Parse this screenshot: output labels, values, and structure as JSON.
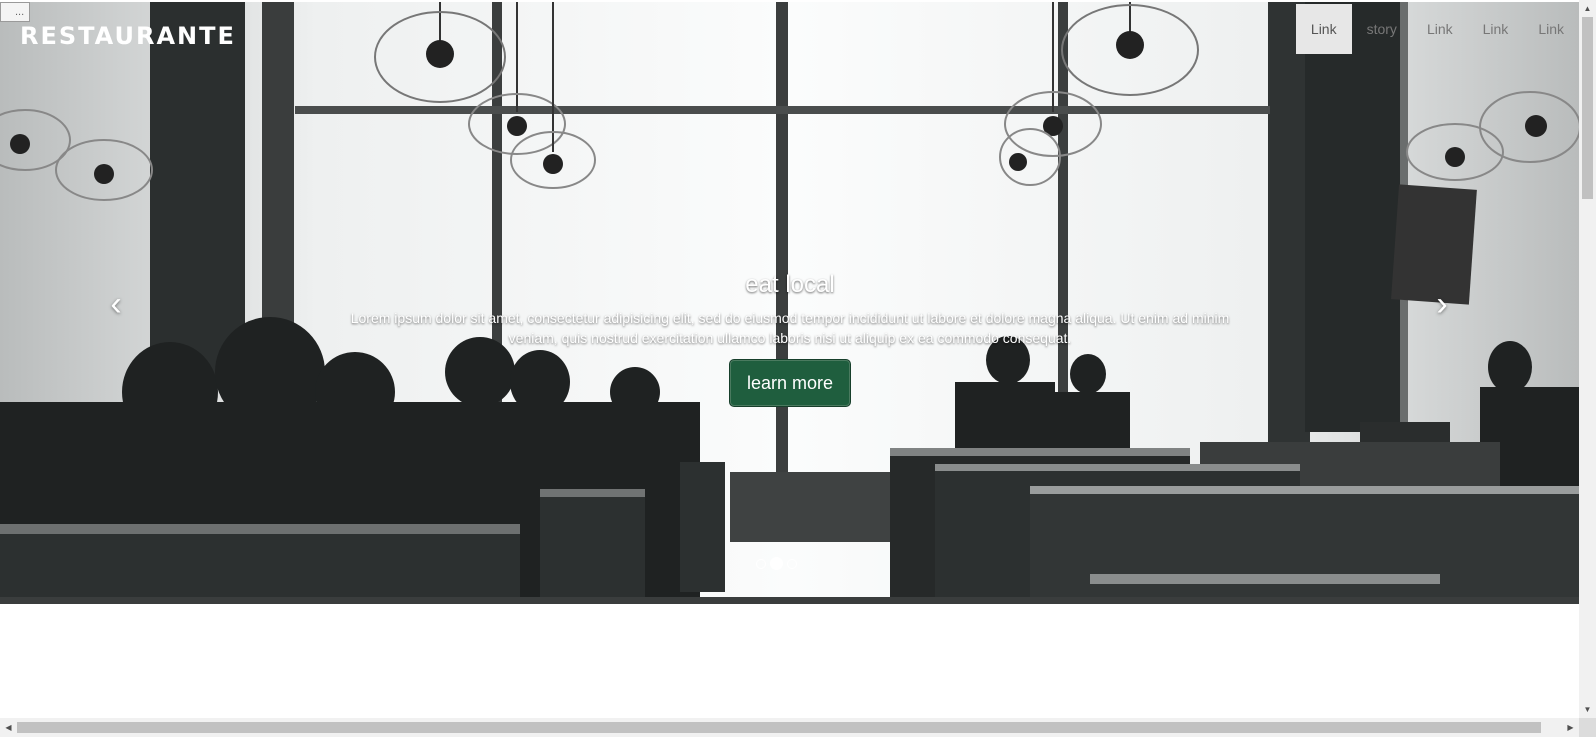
{
  "brand": {
    "name": "RESTAURANTE"
  },
  "broken_image": {
    "alt": "..."
  },
  "nav": {
    "items": [
      {
        "label": "Link",
        "active": true
      },
      {
        "label": "story",
        "active": false
      },
      {
        "label": "Link",
        "active": false
      },
      {
        "label": "Link",
        "active": false
      },
      {
        "label": "Link",
        "active": false
      }
    ]
  },
  "carousel": {
    "caption": {
      "title": "eat local",
      "text": "Lorem ipsum dolor sit amet, consectetur adipisicing elit, sed do eiusmod tempor incididunt ut labore et dolore magna aliqua. Ut enim ad minim veniam, quis nostrud exercitation ullamco laboris nisi ut aliquip ex ea commodo consequat.",
      "button_label": "learn more"
    },
    "prev_icon": "chevron-left-icon",
    "next_icon": "chevron-right-icon",
    "prev_glyph": "‹",
    "next_glyph": "›",
    "indicators": [
      {
        "active": false
      },
      {
        "active": true
      },
      {
        "active": false
      }
    ]
  },
  "scrollbars": {
    "up_glyph": "▲",
    "down_glyph": "▼",
    "left_glyph": "◀",
    "right_glyph": "▶"
  },
  "colors": {
    "accent": "#1f5e3e",
    "nav_active_bg": "#e7e7e7",
    "nav_text": "#777777"
  }
}
